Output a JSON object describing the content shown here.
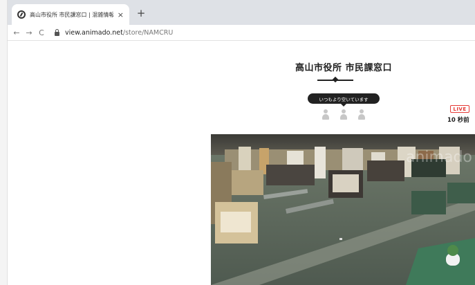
{
  "browser": {
    "tab_title": "高山市役所 市民課窓口 | 混雑情報",
    "tab_close": "×",
    "new_tab": "+",
    "nav": {
      "back": "←",
      "forward": "→",
      "reload": "C"
    },
    "url_domain": "view.animado.net",
    "url_path": "/store/NAMCRU"
  },
  "page": {
    "title": "高山市役所 市民課窓口",
    "status_text": "いつもより空いています",
    "people_icons": [
      "person-icon",
      "person-icon",
      "person-icon"
    ],
    "live_label": "LIVE",
    "live_time": "10 秒前",
    "watermark": "animado"
  },
  "colors": {
    "live_red": "#e53935",
    "pill_bg": "#222222",
    "tab_strip": "#dee1e6"
  }
}
